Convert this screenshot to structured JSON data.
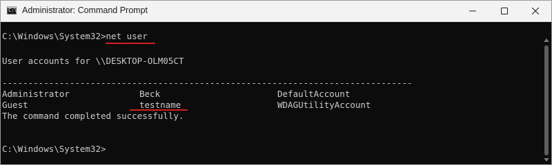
{
  "window": {
    "title": "Administrator: Command Prompt",
    "icon": "cmd-icon",
    "icon_glyph": "C:\\",
    "controls": {
      "minimize_icon": "minimize-icon",
      "maximize_icon": "maximize-icon",
      "close_icon": "close-icon"
    }
  },
  "terminal": {
    "prompt_command": "C:\\Windows\\System32>net user",
    "header": "User accounts for \\\\DESKTOP-OLM05CT",
    "separator": "-------------------------------------------------------------------------------",
    "accounts": [
      [
        "Administrator",
        "Beck",
        "DefaultAccount"
      ],
      [
        "Guest",
        "testname",
        "WDAGUtilityAccount"
      ]
    ],
    "status": "The command completed successfully.",
    "final_prompt": "C:\\Windows\\System32>"
  },
  "colors": {
    "background": "#0c0c0c",
    "text": "#cccccc",
    "annotation": "#d21f1f",
    "titlebar": "#f3f3f3"
  }
}
